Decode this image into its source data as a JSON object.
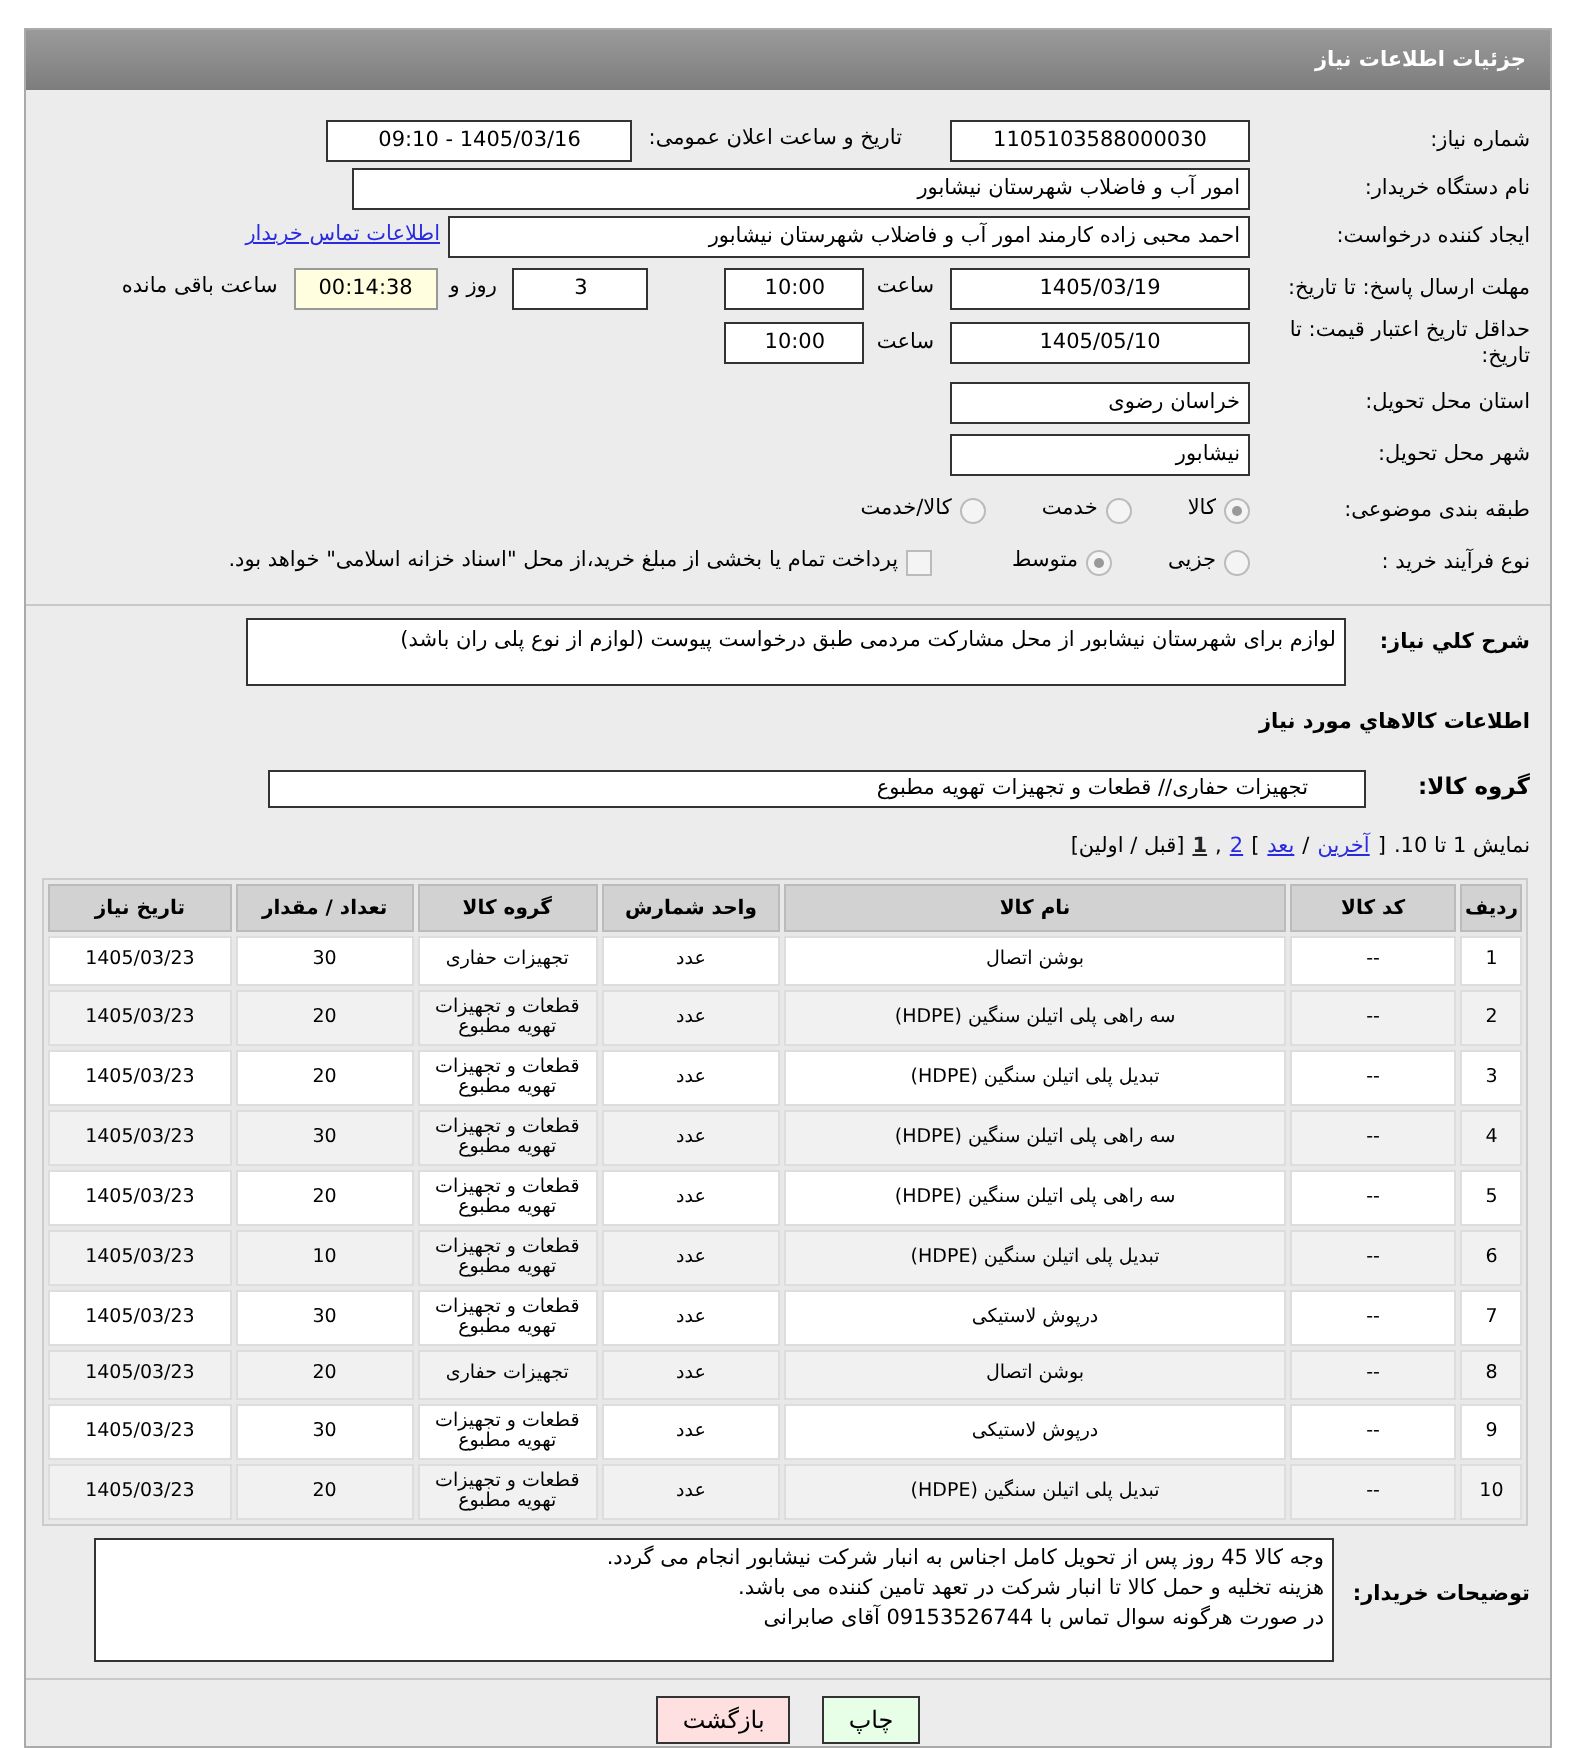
{
  "header": {
    "title": "جزئیات اطلاعات نیاز"
  },
  "need_number": {
    "label": "شماره نیاز:",
    "value": "1105103588000030"
  },
  "announce": {
    "label": "تاریخ و ساعت اعلان عمومی:",
    "value": "1405/03/16 - 09:10"
  },
  "buyer_org": {
    "label": "نام دستگاه خریدار:",
    "value": "امور آب و فاضلاب شهرستان نیشابور"
  },
  "requester": {
    "label": "ایجاد کننده درخواست:",
    "value": "احمد محبی زاده کارمند امور آب و فاضلاب شهرستان نیشابور",
    "link": "اطلاعات تماس خریدار"
  },
  "deadline": {
    "label": "مهلت ارسال پاسخ: تا تاریخ:",
    "date": "1405/03/19",
    "time_label": "ساعت",
    "time": "10:00",
    "days": "3",
    "days_label": "روز و",
    "remaining": "00:14:38",
    "remaining_label": "ساعت باقی مانده"
  },
  "price_validity": {
    "label": "حداقل تاریخ اعتبار قیمت: تا تاریخ:",
    "date": "1405/05/10",
    "time_label": "ساعت",
    "time": "10:00"
  },
  "province": {
    "label": "استان محل تحویل:",
    "value": "خراسان رضوی"
  },
  "city": {
    "label": "شهر محل تحویل:",
    "value": "نیشابور"
  },
  "category": {
    "label": "طبقه بندی موضوعی:",
    "options": [
      {
        "label": "کالا",
        "selected": true
      },
      {
        "label": "خدمت",
        "selected": false
      },
      {
        "label": "کالا/خدمت",
        "selected": false
      }
    ]
  },
  "process": {
    "label": "نوع فرآیند خرید :",
    "options": [
      {
        "label": "جزیی",
        "selected": false
      },
      {
        "label": "متوسط",
        "selected": true
      }
    ],
    "payment_note": {
      "label": "پرداخت تمام یا بخشی از مبلغ خرید،از محل \"اسناد خزانه اسلامی\" خواهد بود.",
      "checked": false
    }
  },
  "description": {
    "label": "شرح کلي نياز:",
    "value": "لوازم برای شهرستان نیشابور از محل مشارکت مردمی طبق درخواست پیوست (لوازم از نوع پلی ران باشد)"
  },
  "goods_title": "اطلاعات کالاهاي مورد نياز",
  "goods_group": {
    "label": "گروه کالا:",
    "value": "تجهیزات حفاری//  قطعات و تجهیزات تهویه مطبوع"
  },
  "pagination": {
    "summary": "نمایش 1 تا 10.",
    "items": [
      {
        "kind": "text",
        "label": "["
      },
      {
        "kind": "link",
        "label": "آخرین"
      },
      {
        "kind": "text",
        "label": "/"
      },
      {
        "kind": "link",
        "label": "بعد"
      },
      {
        "kind": "text",
        "label": "]"
      },
      {
        "kind": "page",
        "label": "2",
        "selected": false
      },
      {
        "kind": "text",
        "label": ","
      },
      {
        "kind": "page",
        "label": "1",
        "selected": true
      }
    ],
    "inactive": "[قبل / اولین]"
  },
  "table": {
    "columns": [
      "ردیف",
      "کد کالا",
      "نام کالا",
      "واحد شمارش",
      "گروه کالا",
      "تعداد / مقدار",
      "تاریخ نیاز"
    ],
    "rows": [
      [
        "1",
        "--",
        "بوشن اتصال",
        "عدد",
        "تجهیزات حفاری",
        "30",
        "1405/03/23"
      ],
      [
        "2",
        "--",
        "سه راهی پلی اتیلن سنگین (HDPE)",
        "عدد",
        "قطعات و تجهیزات تهویه مطبوع",
        "20",
        "1405/03/23"
      ],
      [
        "3",
        "--",
        "تبدیل پلی اتیلن سنگین (HDPE)",
        "عدد",
        "قطعات و تجهیزات تهویه مطبوع",
        "20",
        "1405/03/23"
      ],
      [
        "4",
        "--",
        "سه راهی پلی اتیلن سنگین (HDPE)",
        "عدد",
        "قطعات و تجهیزات تهویه مطبوع",
        "30",
        "1405/03/23"
      ],
      [
        "5",
        "--",
        "سه راهی پلی اتیلن سنگین (HDPE)",
        "عدد",
        "قطعات و تجهیزات تهویه مطبوع",
        "20",
        "1405/03/23"
      ],
      [
        "6",
        "--",
        "تبدیل پلی اتیلن سنگین (HDPE)",
        "عدد",
        "قطعات و تجهیزات تهویه مطبوع",
        "10",
        "1405/03/23"
      ],
      [
        "7",
        "--",
        "درپوش لاستیکی",
        "عدد",
        "قطعات و تجهیزات تهویه مطبوع",
        "30",
        "1405/03/23"
      ],
      [
        "8",
        "--",
        "بوشن اتصال",
        "عدد",
        "تجهیزات حفاری",
        "20",
        "1405/03/23"
      ],
      [
        "9",
        "--",
        "درپوش لاستیکی",
        "عدد",
        "قطعات و تجهیزات تهویه مطبوع",
        "30",
        "1405/03/23"
      ],
      [
        "10",
        "--",
        "تبدیل پلی اتیلن سنگین (HDPE)",
        "عدد",
        "قطعات و تجهیزات تهویه مطبوع",
        "20",
        "1405/03/23"
      ]
    ]
  },
  "notes": {
    "label": "توضیحات خریدار:",
    "lines": [
      "وجه کالا 45 روز پس از تحویل کامل اجناس به انبار شرکت  نیشابور انجام می گردد.",
      "هزینه تخلیه و حمل کالا تا انبار شرکت در تعهد تامین کننده می باشد.",
      "در صورت هرگونه سوال تماس با 09153526744 آقای صابرانی"
    ]
  },
  "buttons": [
    {
      "label": "چاپ",
      "kind": "print"
    },
    {
      "label": "بازگشت",
      "kind": "back"
    }
  ]
}
